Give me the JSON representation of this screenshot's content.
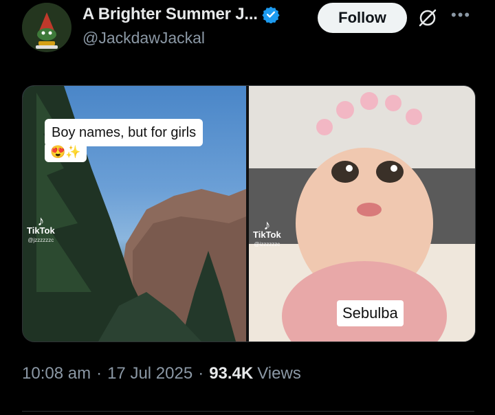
{
  "author": {
    "display_name": "A Brighter Summer J...",
    "handle": "@JackdawJackal",
    "verified": true,
    "avatar_icon": "gnome-avatar"
  },
  "actions": {
    "follow_label": "Follow",
    "grok_icon": "grok-icon",
    "more_icon": "more-icon"
  },
  "media": {
    "left": {
      "caption": "Boy names, but for girls",
      "caption_emoji": "😍✨",
      "watermark_brand": "TikTok",
      "watermark_user": "@jzzzzzzc"
    },
    "right": {
      "name_label": "Sebulba",
      "watermark_brand": "TikTok",
      "watermark_user": "@izzzzzzc"
    }
  },
  "meta": {
    "time": "10:08 am",
    "date": "17 Jul 2025",
    "views_count": "93.4K",
    "views_label": "Views"
  },
  "colors": {
    "verified_blue": "#1d9bf0",
    "muted_text": "#8b98a5",
    "follow_bg": "#eff3f4"
  }
}
